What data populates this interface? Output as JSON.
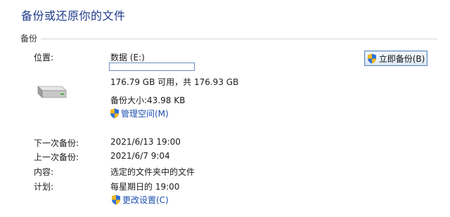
{
  "window": {
    "title": "备份或还原你的文件"
  },
  "section": {
    "label": "备份"
  },
  "location": {
    "label": "位置:",
    "drive_name": "数据 (E:)",
    "usage_fraction": 0.0001,
    "space_text": "176.79 GB 可用，共 176.93 GB",
    "backup_size": "备份大小:43.98 KB",
    "manage_link": "管理空间(M)"
  },
  "backup_now_button": "立即备份(B)",
  "details": {
    "next_label": "下一次备份:",
    "next_value": "2021/6/13 19:00",
    "last_label": "上一次备份:",
    "last_value": "2021/6/7 9:04",
    "contents_label": "内容:",
    "contents_value": "选定的文件夹中的文件",
    "schedule_label": "计划:",
    "schedule_value": "每星期日的 19:00",
    "change_settings_link": "更改设置(C)"
  },
  "icons": {
    "drive": "hard-drive-icon",
    "shield": "uac-shield-icon"
  },
  "colors": {
    "title": "#1e3a8a",
    "link": "#1d4fb0",
    "usage_fill": "#4a90d9"
  }
}
